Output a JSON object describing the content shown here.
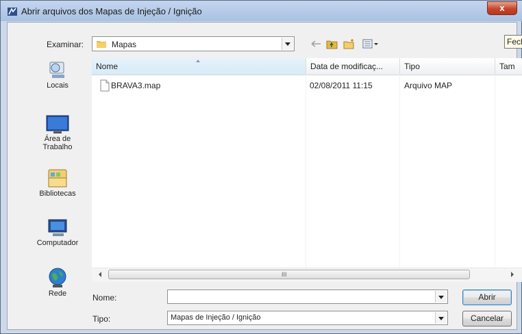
{
  "window": {
    "title": "Abrir arquivos dos Mapas de Injeção / Ignição",
    "close_label": "x"
  },
  "toolbar": {
    "look_in_label": "Examinar:",
    "look_in_value": "Mapas"
  },
  "side_tooltip": "Fech",
  "places": [
    {
      "label": "Locais"
    },
    {
      "label": "Área de Trabalho"
    },
    {
      "label": "Bibliotecas"
    },
    {
      "label": "Computador"
    },
    {
      "label": "Rede"
    }
  ],
  "columns": {
    "name": "Nome",
    "date": "Data de modificaç...",
    "type": "Tipo",
    "size": "Tam"
  },
  "files": [
    {
      "name": "BRAVA3.map",
      "date": "02/08/2011 11:15",
      "type": "Arquivo MAP"
    }
  ],
  "scrollbar_grip": "III",
  "form": {
    "name_label": "Nome:",
    "name_value": "",
    "type_label": "Tipo:",
    "type_value": "Mapas de Injeção / Ignição",
    "open_button": "Abrir",
    "cancel_button": "Cancelar"
  },
  "colors": {
    "header_sort": "#d7ebf8",
    "client_bg": "#f0f0f0",
    "close": "#c5462b"
  }
}
